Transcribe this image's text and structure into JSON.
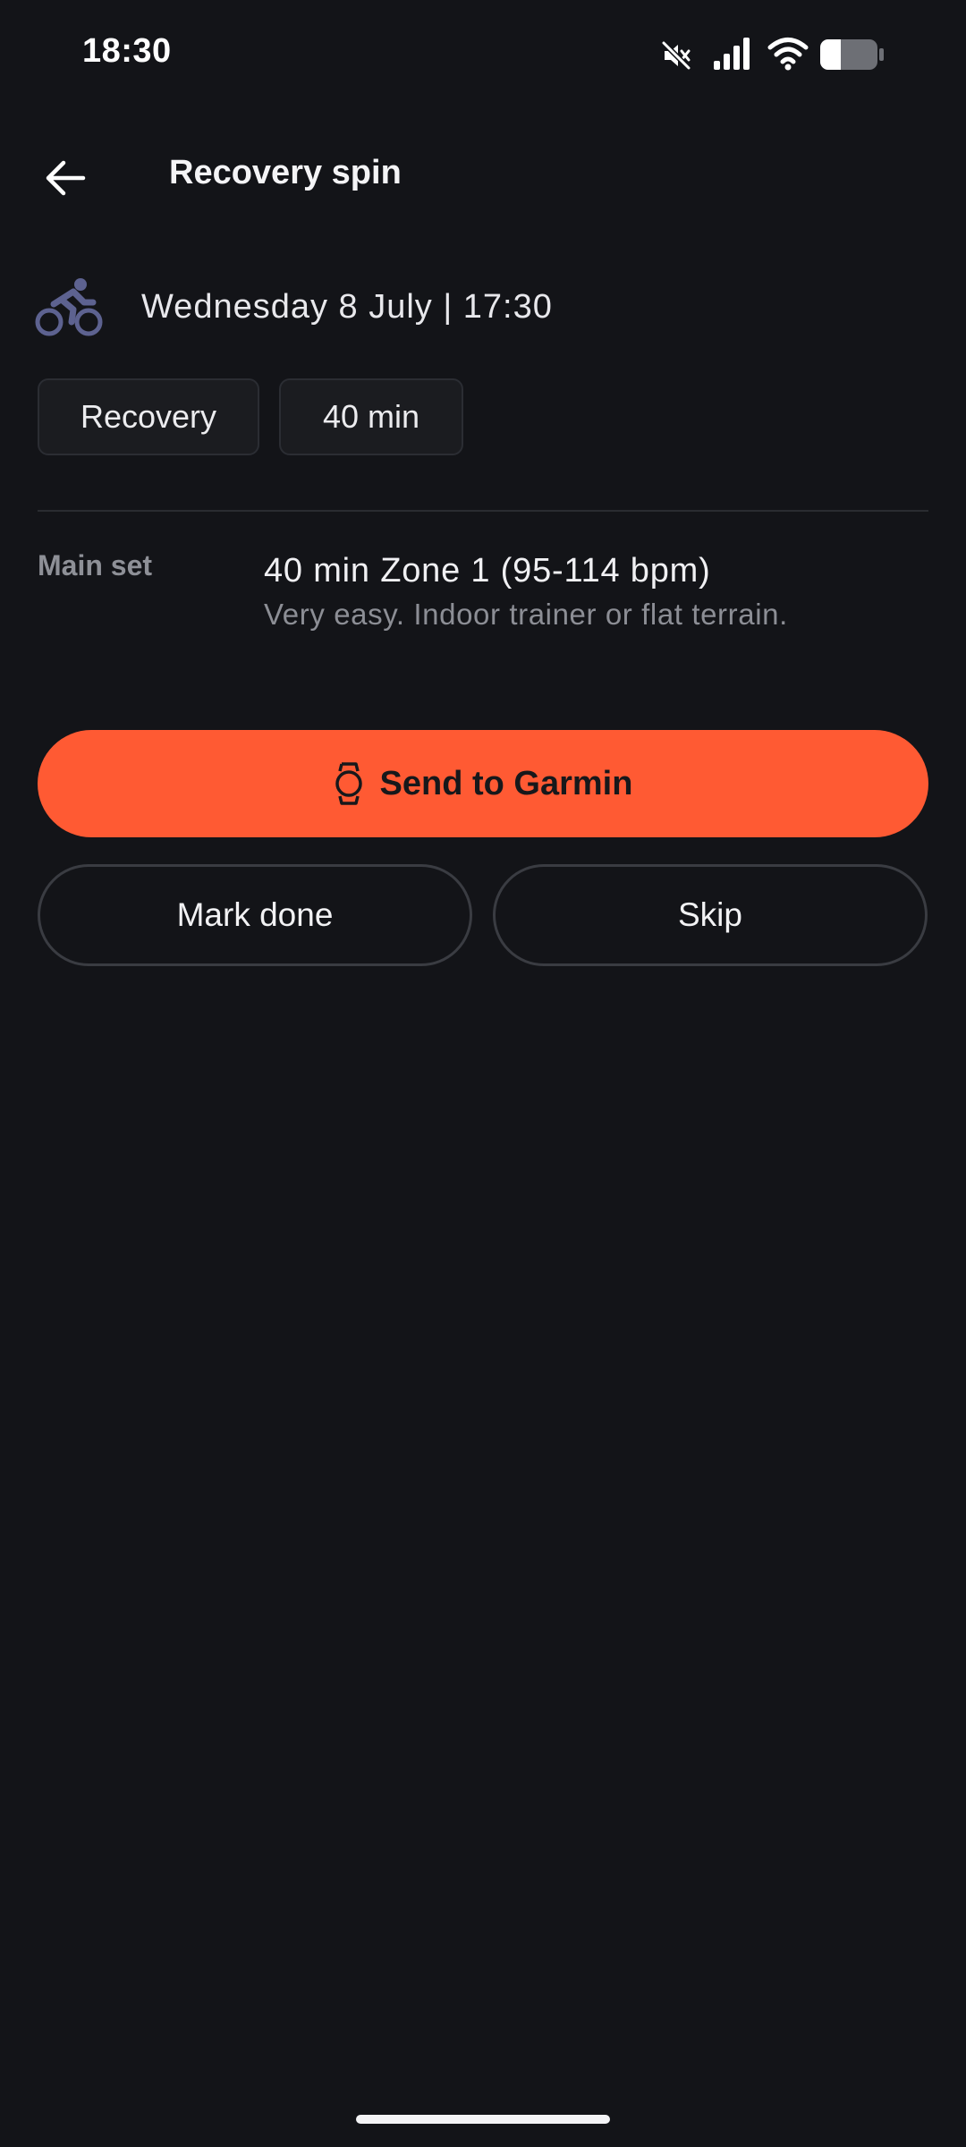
{
  "status_bar": {
    "time": "18:30",
    "icons": [
      "mute-icon",
      "signal-icon",
      "wifi-icon",
      "battery-icon"
    ]
  },
  "header": {
    "title": "Recovery spin",
    "back_icon": "back-arrow-icon"
  },
  "activity": {
    "icon": "bike-icon",
    "datetime": "Wednesday 8 July | 17:30"
  },
  "chips": [
    {
      "label": "Recovery"
    },
    {
      "label": "40 min"
    }
  ],
  "main_set": {
    "label": "Main set",
    "title": "40 min Zone 1 (95-114 bpm)",
    "description": "Very easy. Indoor trainer or flat terrain."
  },
  "actions": {
    "send_label": "Send to Garmin",
    "send_icon": "watch-icon",
    "mark_done_label": "Mark done",
    "skip_label": "Skip"
  },
  "colors": {
    "background": "#131418",
    "accent": "#ff5a33",
    "muted_text": "#8c8e95",
    "activity_icon": "#5d6290"
  }
}
